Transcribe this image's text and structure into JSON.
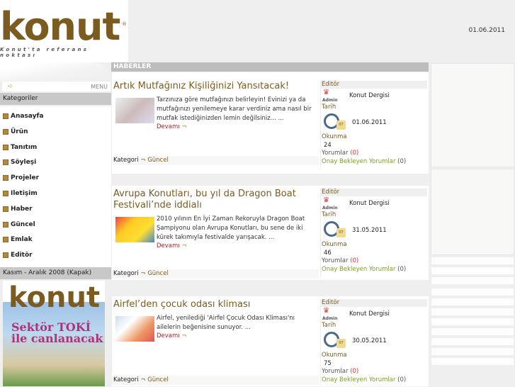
{
  "header": {
    "logo_text": "konut",
    "logo_tagline": "Konut'ta referans noktası",
    "date": "01.06.2011",
    "menu_label": "MENU"
  },
  "sidebar": {
    "categories_title": "Kategoriler",
    "items": [
      {
        "label": "Anasayfa"
      },
      {
        "label": "Ürün"
      },
      {
        "label": "Tanıtım"
      },
      {
        "label": "Söyleşi"
      },
      {
        "label": "Projeler"
      },
      {
        "label": "Iletişim"
      },
      {
        "label": "Haber"
      },
      {
        "label": "Güncel"
      },
      {
        "label": "Emlak"
      },
      {
        "label": "Editör"
      }
    ],
    "cover_title": "Kasım - Aralık 2008 (Kapak)",
    "cover_text": {
      "logo": "konut",
      "headline": "Sektör TOKİ ile canlanacak"
    }
  },
  "news": {
    "section_title": "HABERLER",
    "labels": {
      "editor": "Editör",
      "date": "Tarih",
      "reads": "Okunma",
      "comments": "Yorumlar",
      "pending": "Onay Bekleyen Yorumlar",
      "more": "Devamı",
      "more_arrow": "¬",
      "category": "Kategori",
      "cat_arrow": "¬",
      "admin": "Admin"
    },
    "articles": [
      {
        "title": "Artık Mutfağınız Kişiliğinizi Yansıtacak!",
        "summary": "Tarzınıza göre mutfağınızı belirleyin! Evinizi ya da mutfağınızı yenilemeye karar verdiniz ama nasıl bir mutfak istediğinizden lemin değilsiniz... ...",
        "editor": "Konut Dergisi",
        "date": "01.06.2011",
        "reads": "24",
        "comments": "(0)",
        "pending": "(0)",
        "category": "Güncel",
        "cal_day": "07"
      },
      {
        "title": "Avrupa Konutları, bu yıl da Dragon Boat Festivali’nde iddialı",
        "summary": "2010 yılının En İyi Zaman Rekoruyla Dragon Boat Şampiyonu olan Avrupa Konutları, bu sene de iki kürek takımıyla festivalde yarışacak. ...",
        "editor": "Konut Dergisi",
        "date": "31.05.2011",
        "reads": "46",
        "comments": "(0)",
        "pending": "(0)",
        "category": "Güncel",
        "cal_day": "07"
      },
      {
        "title": "Airfel’den çocuk odası kliması",
        "summary": "Airfel, yenilediği 'Airfel Çocuk Odası Kliması'nı ailelerin beğenisine sunuyor. ...",
        "editor": "Konut Dergisi",
        "date": "30.05.2011",
        "reads": "75",
        "comments": "(0)",
        "pending": "(0)",
        "category": "Güncel",
        "cal_day": "07"
      }
    ]
  }
}
